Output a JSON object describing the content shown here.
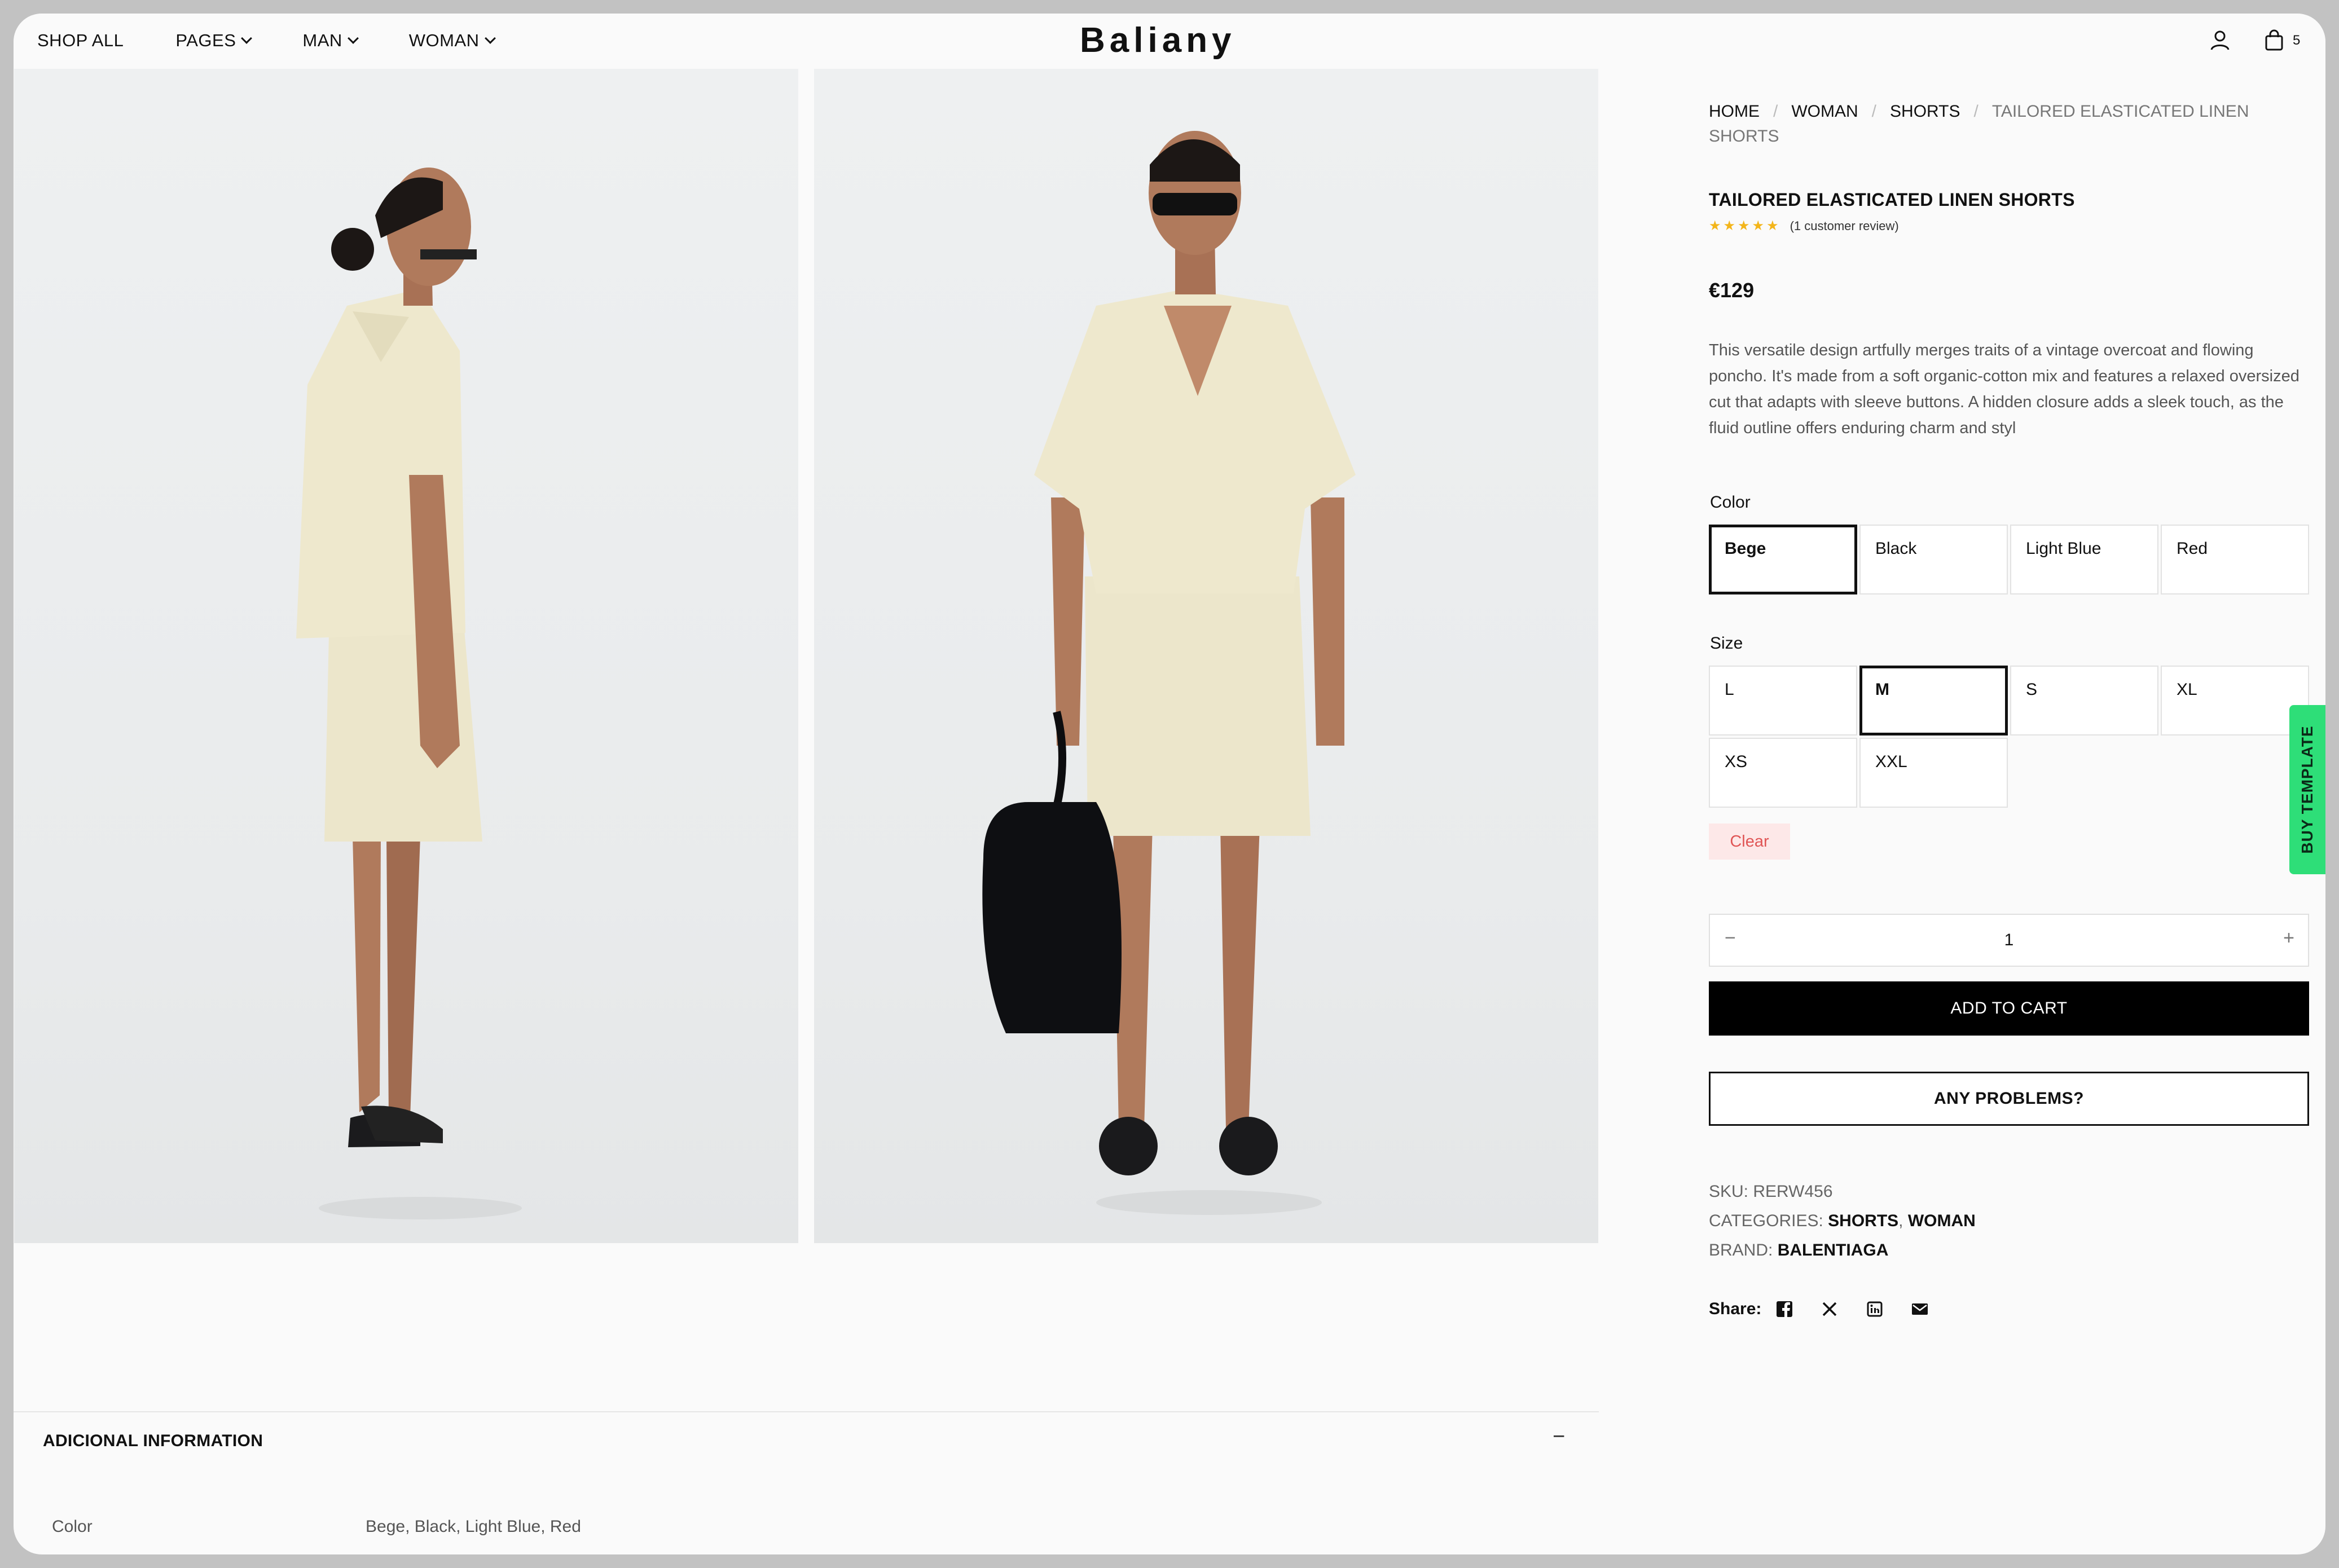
{
  "header": {
    "nav": [
      {
        "label": "SHOP ALL",
        "dropdown": false
      },
      {
        "label": "PAGES",
        "dropdown": true
      },
      {
        "label": "MAN",
        "dropdown": true
      },
      {
        "label": "WOMAN",
        "dropdown": true
      }
    ],
    "logo": "Baliany",
    "cart_count": "5",
    "icons": [
      "user-icon",
      "shopping-bag-icon"
    ]
  },
  "gallery": {
    "images": [
      "model-side-view",
      "model-front-view-with-bag"
    ]
  },
  "product": {
    "breadcrumb": [
      {
        "label": "HOME",
        "link": true
      },
      {
        "label": "WOMAN",
        "link": true
      },
      {
        "label": "SHORTS",
        "link": true
      },
      {
        "label": "TAILORED ELASTICATED LINEN SHORTS",
        "link": false
      }
    ],
    "title": "TAILORED ELASTICATED LINEN SHORTS",
    "rating": 5,
    "review_text": "(1 customer review)",
    "price": "€129",
    "description": "This versatile design artfully merges traits of a vintage overcoat and flowing poncho. It's made from a soft organic-cotton mix and features a relaxed oversized cut that adapts with sleeve buttons. A hidden closure adds a sleek touch, as the fluid outline offers enduring charm and styl",
    "color_label": "Color",
    "colors": [
      {
        "label": "Bege",
        "selected": true
      },
      {
        "label": "Black",
        "selected": false
      },
      {
        "label": "Light Blue",
        "selected": false
      },
      {
        "label": "Red",
        "selected": false
      }
    ],
    "size_label": "Size",
    "sizes": [
      {
        "label": "L",
        "selected": false
      },
      {
        "label": "M",
        "selected": true
      },
      {
        "label": "S",
        "selected": false
      },
      {
        "label": "XL",
        "selected": false
      },
      {
        "label": "XS",
        "selected": false
      },
      {
        "label": "XXL",
        "selected": false
      }
    ],
    "clear_label": "Clear",
    "quantity": "1",
    "minus_symbol": "−",
    "plus_symbol": "+",
    "add_to_cart": "ADD TO CART",
    "problems_button": "ANY PROBLEMS?",
    "sku_label": "SKU:",
    "sku": "RERW456",
    "categories_label": "CATEGORIES:",
    "categories": [
      "SHORTS",
      "WOMAN"
    ],
    "category_separator": ",",
    "brand_label": "BRAND:",
    "brand": "BALENTIAGA",
    "share_label": "Share:",
    "share_icons": [
      "facebook-icon",
      "x-icon",
      "linkedin-icon",
      "email-icon"
    ]
  },
  "side_tab": "BUY TEMPLATE",
  "additional_info": {
    "title": "ADICIONAL INFORMATION",
    "toggle": "−",
    "rows": [
      {
        "key": "Color",
        "value": "Bege, Black, Light Blue, Red"
      }
    ]
  },
  "colors": {
    "accent_green": "#2ede78",
    "star_yellow": "#f3b51a",
    "clear_red": "#e05555",
    "button_black": "#000000"
  }
}
